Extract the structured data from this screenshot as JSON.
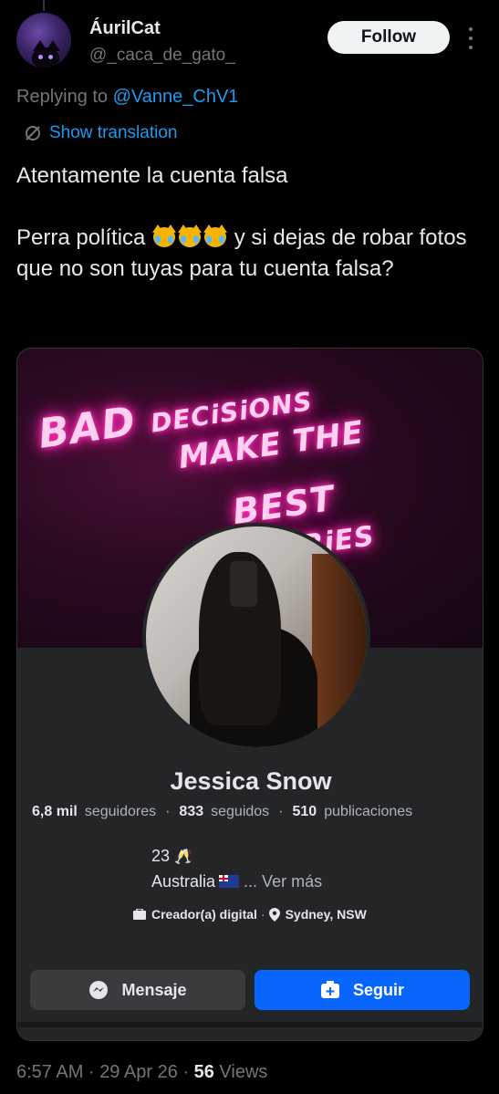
{
  "author": {
    "display_name": "ÁurilCat",
    "handle": "@_caca_de_gato_"
  },
  "follow_label": "Follow",
  "reply_context": {
    "prefix": "Replying to ",
    "mention": "@Vanne_ChV1"
  },
  "translation_label": "Show translation",
  "tweet": {
    "line1": "Atentamente la cuenta falsa",
    "line2_start": "Perra política ",
    "line2_end": " y si dejas de robar fotos que no son tuyas para tu cuenta falsa?"
  },
  "card": {
    "cover_text": {
      "w1": "BAD",
      "w2": "DECiSiONS",
      "w3": "MAKE THE",
      "w4": "BEST",
      "w5": "STORiES"
    },
    "profile_name": "Jessica Snow",
    "stats": {
      "followers_count": "6,8 mil",
      "followers_label": "seguidores",
      "following_count": "833",
      "following_label": "seguidos",
      "posts_count": "510",
      "posts_label": "publicaciones",
      "separator": "·"
    },
    "bio": {
      "age": "23",
      "country": "Australia",
      "see_more": "... Ver más"
    },
    "meta": {
      "category": "Creador(a) digital",
      "location": "Sydney, NSW",
      "separator": "·"
    },
    "buttons": {
      "message": "Mensaje",
      "follow": "Seguir"
    }
  },
  "footer": {
    "time": "6:57 AM",
    "date": "29 Apr 26",
    "separator": "·",
    "views_count": "56",
    "views_label": "Views"
  }
}
